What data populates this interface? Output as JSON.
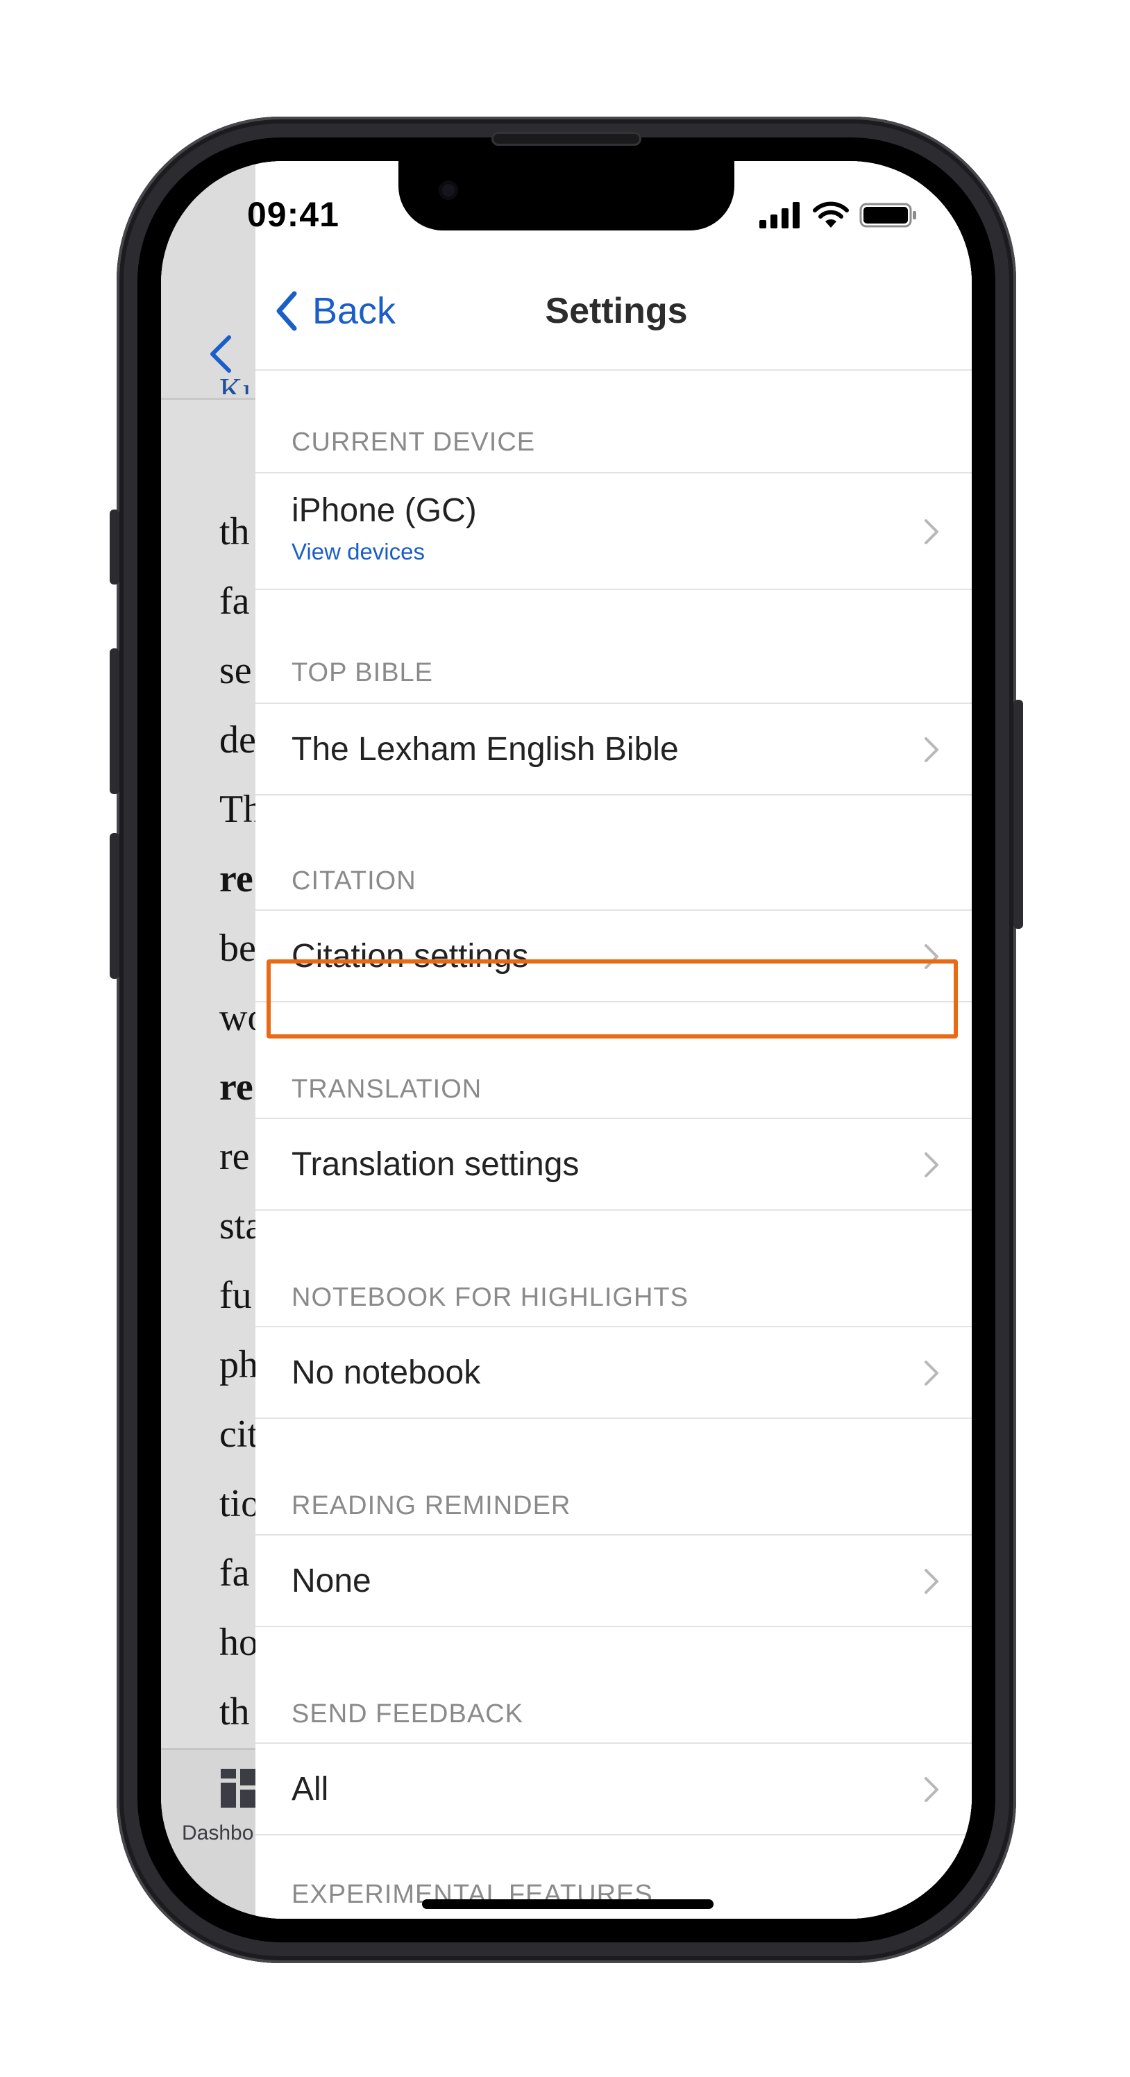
{
  "status_bar": {
    "time": "09:41"
  },
  "background_reader": {
    "title_fragment": "Kı",
    "text_fragments": [
      "th",
      "fa",
      "se",
      "de",
      "Th",
      "re",
      "be",
      "wo",
      "re",
      "re",
      "sta",
      "fu",
      "ph",
      "cit",
      "tio",
      "fa",
      "ho",
      "th"
    ],
    "bold_rows": [
      5,
      8
    ],
    "tab_label": "Dashbo"
  },
  "nav": {
    "back_label": "Back",
    "title": "Settings"
  },
  "sections": [
    {
      "header": "CURRENT DEVICE",
      "row_label": "iPhone (GC)",
      "row_sub": "View devices"
    },
    {
      "header": "TOP BIBLE",
      "row_label": "The Lexham English Bible"
    },
    {
      "header": "CITATION",
      "row_label": "Citation settings"
    },
    {
      "header": "TRANSLATION",
      "row_label": "Translation settings"
    },
    {
      "header": "NOTEBOOK FOR HIGHLIGHTS",
      "row_label": "No notebook"
    },
    {
      "header": "READING REMINDER",
      "row_label": "None"
    },
    {
      "header": "SEND FEEDBACK",
      "row_label": "All"
    },
    {
      "header": "EXPERIMENTAL FEATURES"
    }
  ],
  "colors": {
    "accent_blue": "#1a5ec9",
    "highlight_orange": "#e86a15",
    "section_header_gray": "#8a8a8a"
  },
  "highlighted_row": "Citation settings"
}
